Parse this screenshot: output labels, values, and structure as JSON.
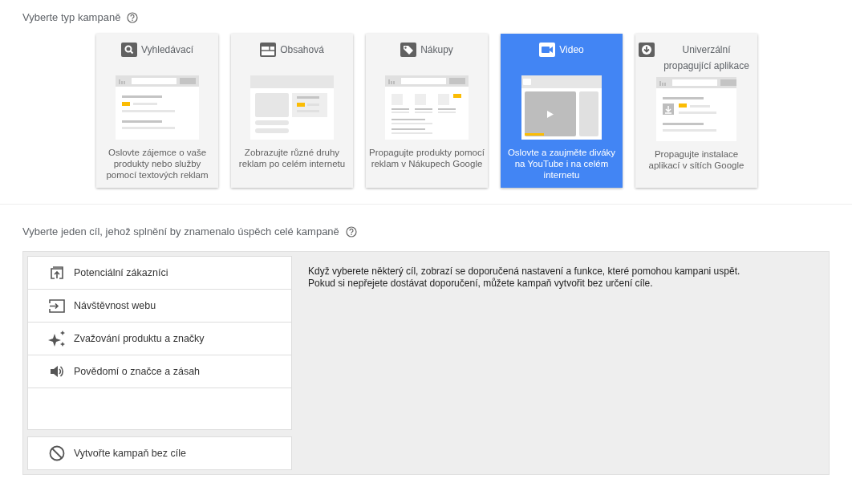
{
  "campaign_type": {
    "heading": "Vyberte typ kampaně",
    "cards": [
      {
        "kind": "search",
        "title": "Vyhledávací",
        "description": "Oslovte zájemce o vaše produkty nebo služby pomocí textových reklam",
        "selected": false
      },
      {
        "kind": "display",
        "title": "Obsahová",
        "description": "Zobrazujte různé druhy reklam po celém internetu",
        "selected": false
      },
      {
        "kind": "shopping",
        "title": "Nákupy",
        "description": "Propagujte produkty pomocí reklam v Nákupech Google",
        "selected": false
      },
      {
        "kind": "video",
        "title": "Video",
        "description": "Oslovte a zaujměte diváky na YouTube i na celém internetu",
        "selected": true
      },
      {
        "kind": "app",
        "title": "Univerzální propagující aplikace",
        "description": "Propagujte instalace aplikací v sítích Google",
        "selected": false
      }
    ]
  },
  "goal": {
    "heading": "Vyberte jeden cíl, jehož splnění by znamenalo úspěch celé kampaně",
    "goals": [
      {
        "kind": "leads",
        "label": "Potenciální zákazníci"
      },
      {
        "kind": "traffic",
        "label": "Návštěvnost webu"
      },
      {
        "kind": "consideration",
        "label": "Zvažování produktu a značky"
      },
      {
        "kind": "awareness",
        "label": "Povědomí o značce a zásah"
      }
    ],
    "no_goal": {
      "label": "Vytvořte kampaň bez cíle"
    },
    "info": [
      "Když vyberete některý cíl, zobrazí se doporučená nastavení a funkce, které pomohou kampani uspět.",
      "Pokud si nepřejete dostávat doporučení, můžete kampaň vytvořit bez určení cíle."
    ]
  }
}
